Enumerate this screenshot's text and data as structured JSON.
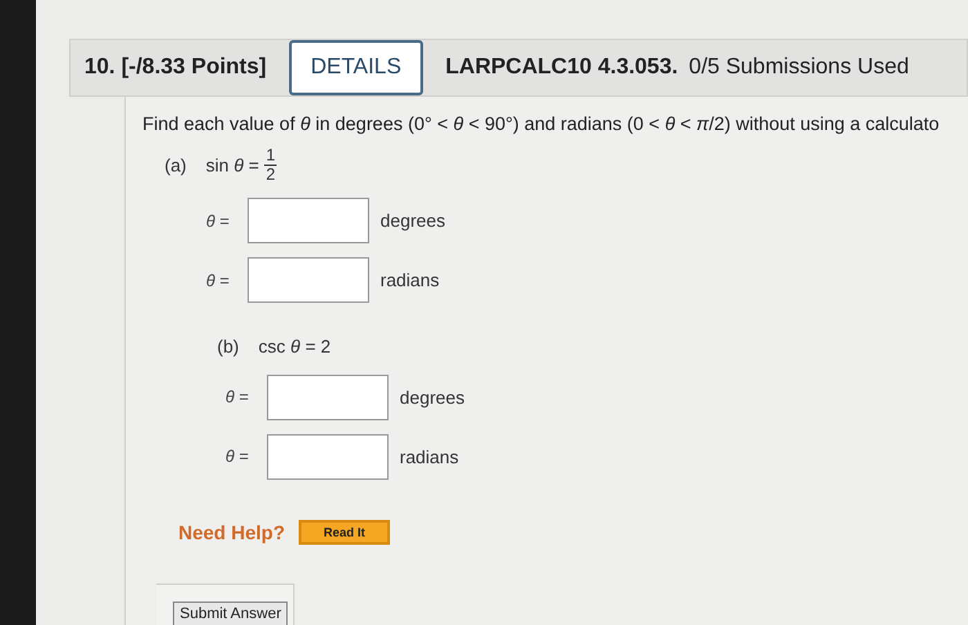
{
  "question": {
    "number": "10.",
    "points": "[-/8.33 Points]",
    "details_button": "DETAILS",
    "code": "LARPCALC10 4.3.053.",
    "submissions": "0/5 Submissions Used"
  },
  "instructions": "Find each value of *θ* in degrees (0° < *θ* < 90°) and radians (0 < *θ* < *π*/2) without using a calculato",
  "parts": [
    {
      "label": "(a)",
      "equation": "sin *θ* =",
      "fraction": {
        "numerator": "1",
        "denominator": "2"
      },
      "answers": [
        {
          "prefix": "*θ* =",
          "unit": "degrees"
        },
        {
          "prefix": "*θ* =",
          "unit": "radians"
        }
      ]
    },
    {
      "label": "(b)",
      "equation": "csc *θ* = 2",
      "answers": [
        {
          "prefix": "*θ* =",
          "unit": "degrees"
        },
        {
          "prefix": "*θ* =",
          "unit": "radians"
        }
      ]
    }
  ],
  "help": {
    "label": "Need Help?",
    "button": "Read It"
  },
  "submit_button": "Submit Answer"
}
